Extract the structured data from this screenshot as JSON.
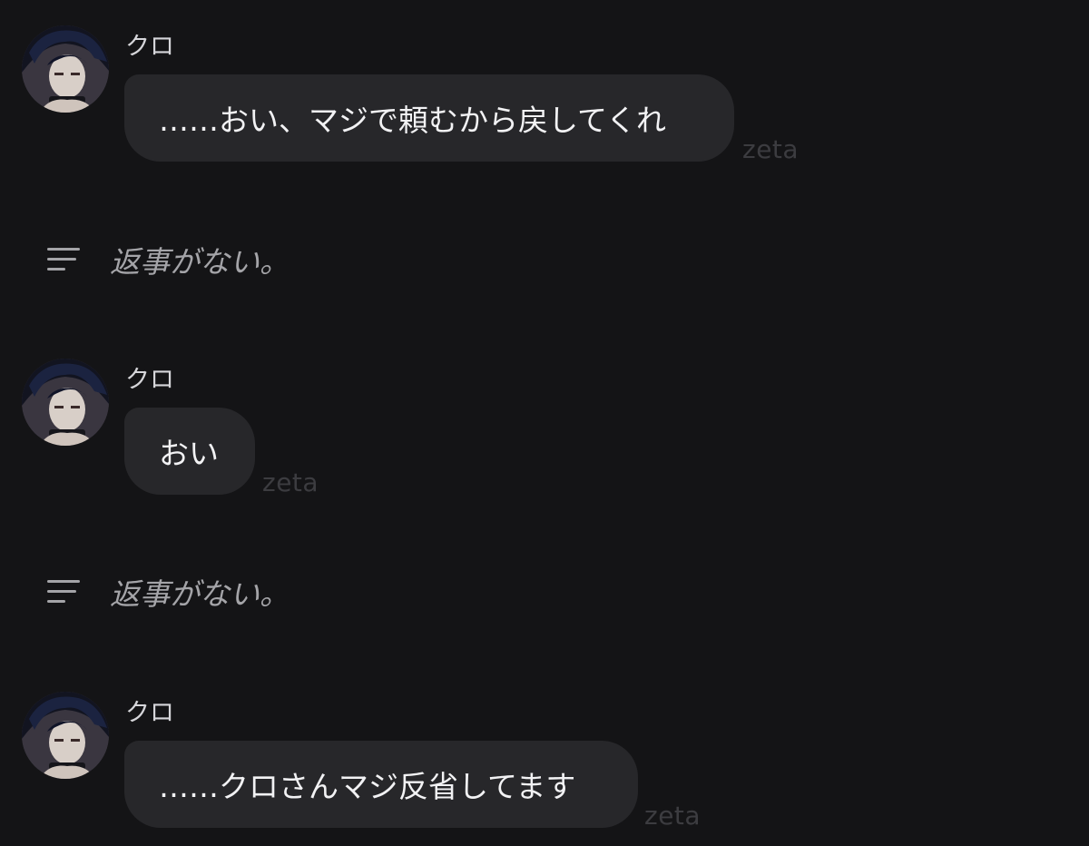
{
  "messages": [
    {
      "sender": "クロ",
      "text": "……おい、マジで頼むから戻してくれ",
      "watermark": "zeta"
    },
    {
      "sender": "クロ",
      "text": "おい",
      "watermark": "zeta"
    },
    {
      "sender": "クロ",
      "text": "……クロさんマジ反省してます",
      "watermark": "zeta"
    }
  ],
  "narrations": [
    {
      "icon": "narration-lines-icon",
      "text": "返事がない。"
    },
    {
      "icon": "narration-lines-icon",
      "text": "返事がない。"
    }
  ],
  "colors": {
    "background": "#141416",
    "bubble": "#27272a",
    "bubble_text": "#f2f2f4",
    "sender_text": "#d6d6da",
    "narration_text": "#a4a4a8",
    "watermark": "#3c3c40"
  }
}
